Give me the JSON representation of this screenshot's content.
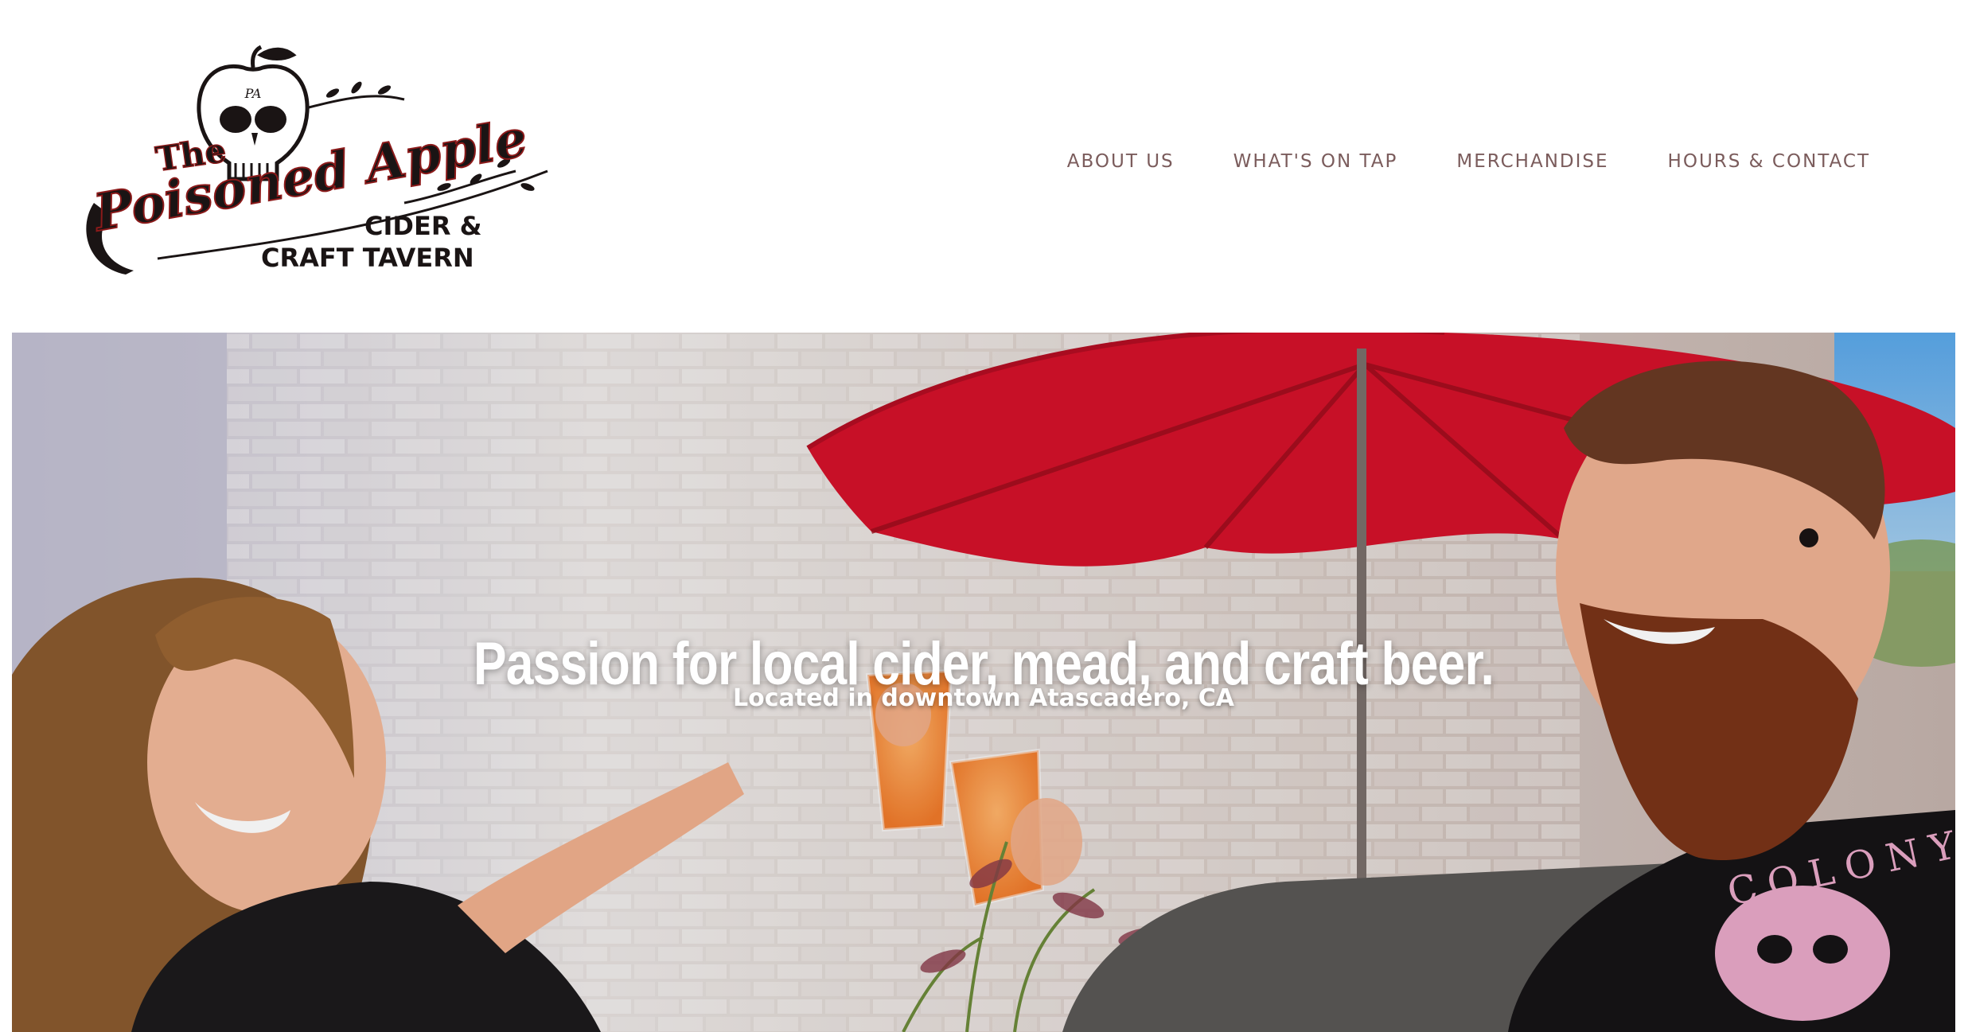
{
  "brand": {
    "logo_line1": "The",
    "logo_line2": "Poisoned Apple",
    "logo_line3": "CIDER &",
    "logo_line4": "CRAFT TAVERN",
    "logo_monogram": "PA"
  },
  "nav": {
    "items": [
      {
        "label": "ABOUT US"
      },
      {
        "label": "WHAT'S ON TAP"
      },
      {
        "label": "MERCHANDISE"
      },
      {
        "label": "HOURS & CONTACT"
      }
    ]
  },
  "hero": {
    "title": "Passion for local cider, mead, and craft beer.",
    "subtitle": "Located in downtown Atascadero, CA",
    "shirt_text": "COLONY"
  },
  "colors": {
    "nav_text": "#7b5c5c",
    "logo_ink": "#1a1414",
    "logo_accent": "#8b1a1a",
    "umbrella_red": "#d4122a"
  }
}
